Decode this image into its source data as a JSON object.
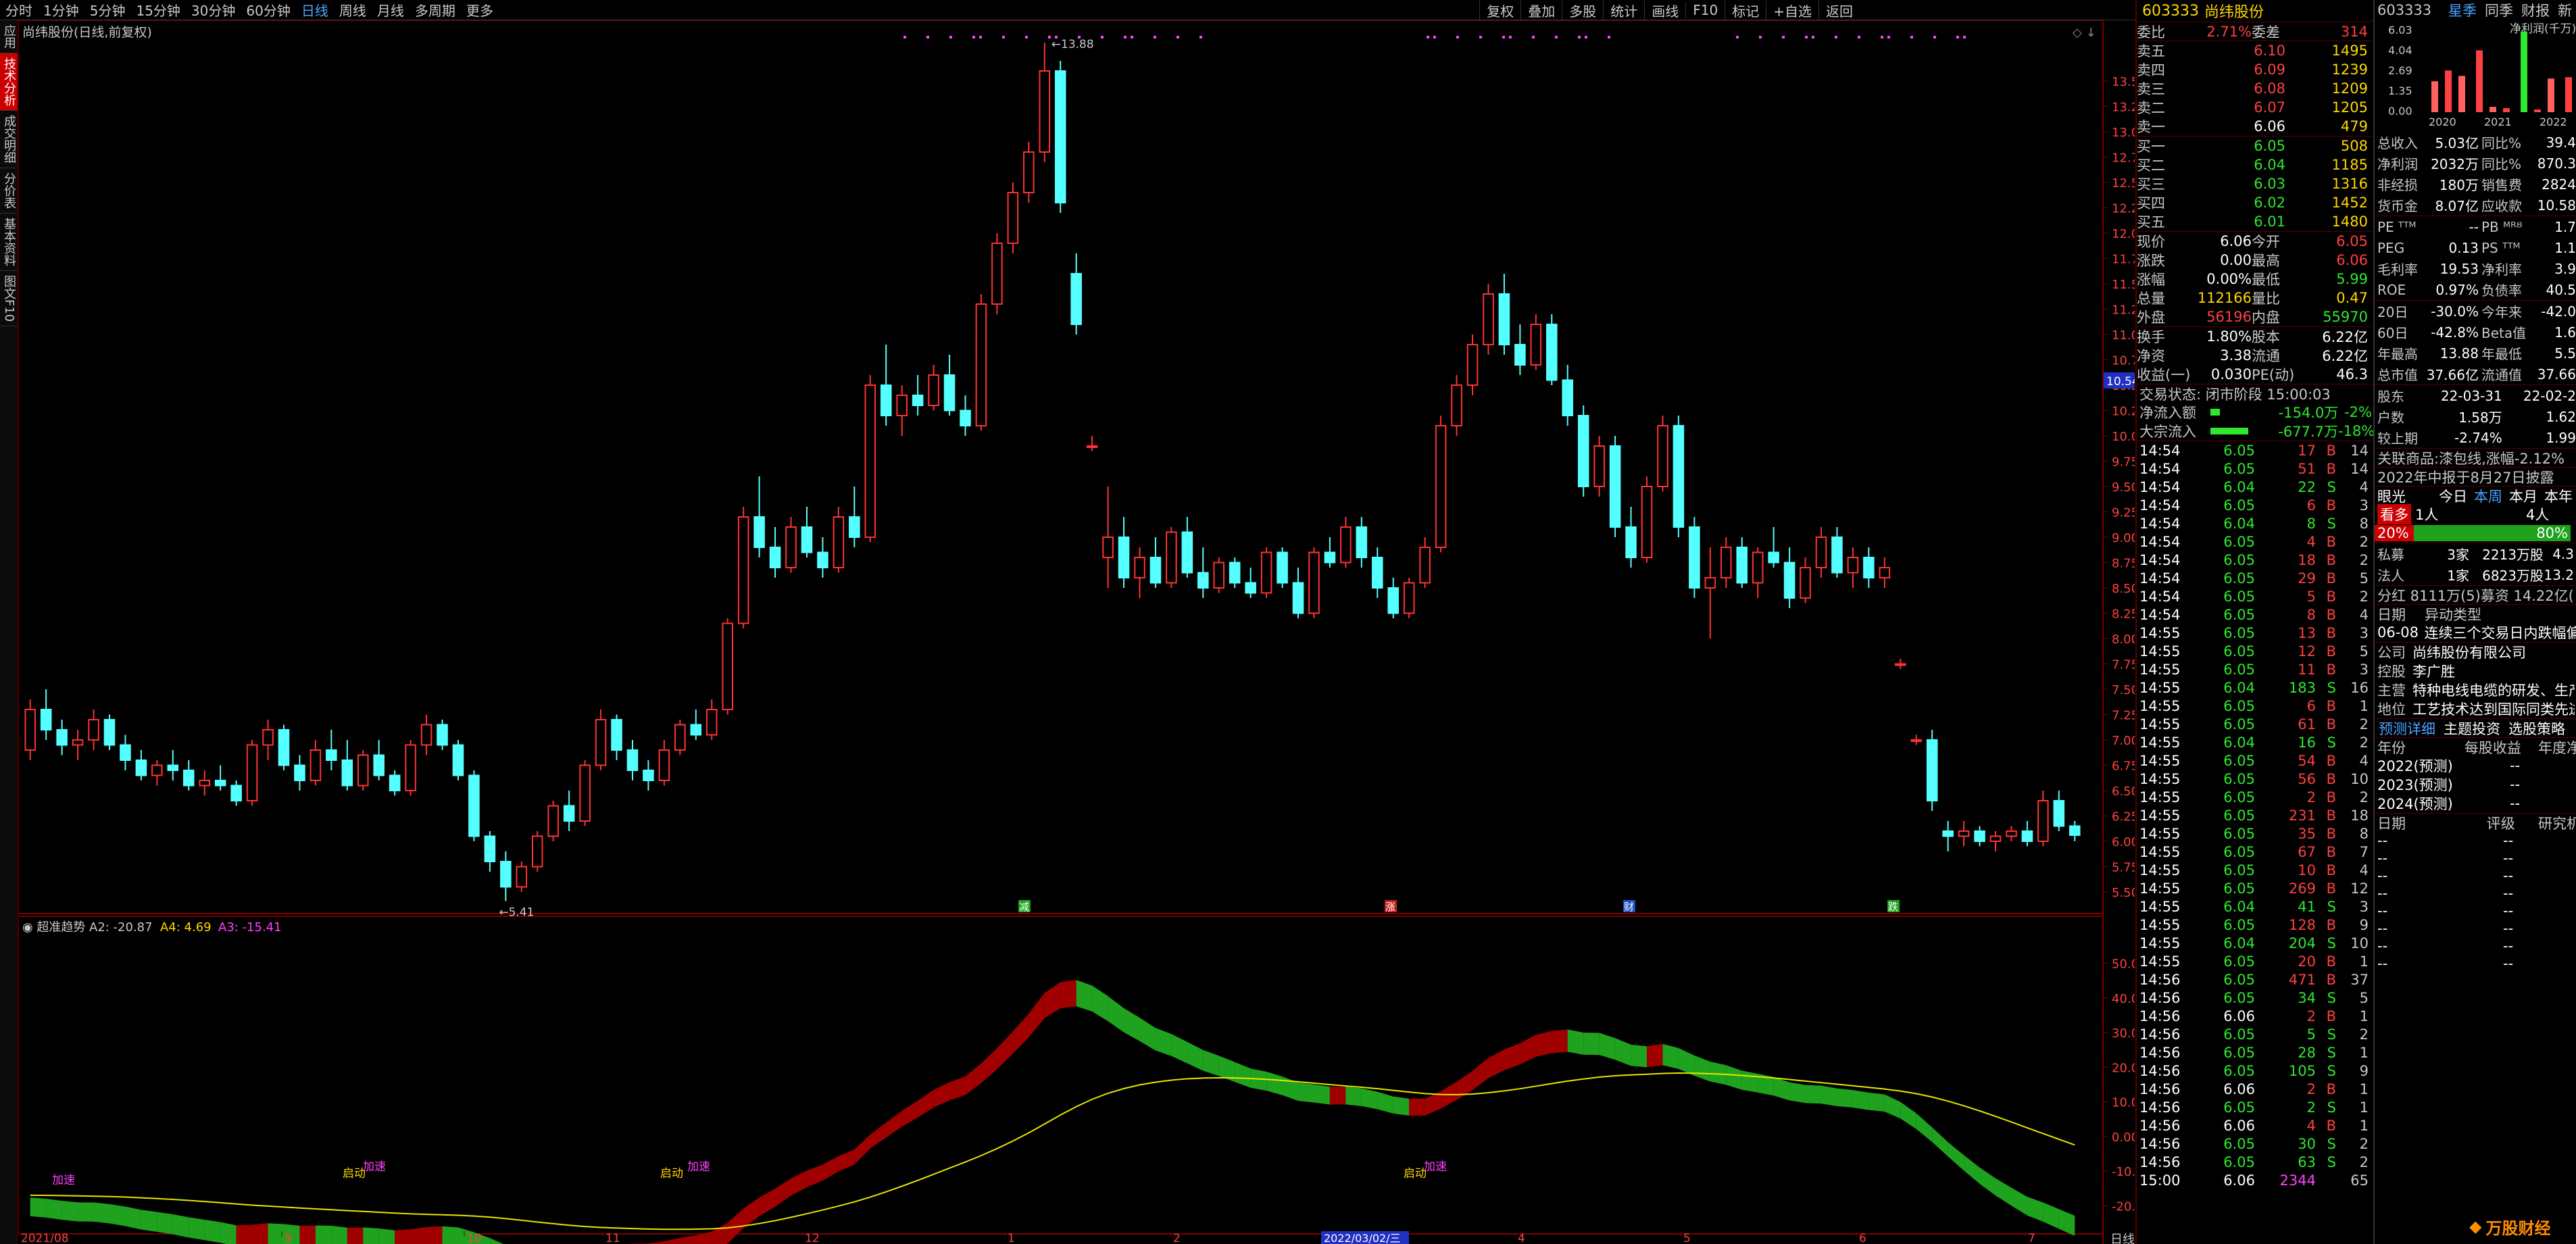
{
  "colors": {
    "up": "#ff3232",
    "down": "#54ffff",
    "bg": "#000000",
    "ma": "#e6e600",
    "bull": "#a00000",
    "bear": "#1fa31f"
  },
  "timeframes": [
    "分时",
    "1分钟",
    "5分钟",
    "15分钟",
    "30分钟",
    "60分钟",
    "日线",
    "周线",
    "月线",
    "多周期",
    "更多"
  ],
  "active_timeframe": "日线",
  "toolbar_right": [
    "复权",
    "叠加",
    "多股",
    "统计",
    "画线",
    "F10",
    "标记",
    "+自选",
    "返回"
  ],
  "left_tabs": [
    "应用",
    "技术分析",
    "成交明细",
    "分价表",
    "基本资料",
    "图文F10"
  ],
  "chart_title": "尚纬股份(日线,前复权)",
  "price_axis": [
    "13.50",
    "13.25",
    "13.00",
    "12.75",
    "12.50",
    "12.25",
    "12.00",
    "11.75",
    "11.50",
    "11.25",
    "11.00",
    "10.75",
    "10.50",
    "10.25",
    "10.00",
    "9.75",
    "9.50",
    "9.25",
    "9.00",
    "8.75",
    "8.50",
    "8.25",
    "8.00",
    "7.75",
    "7.50",
    "7.25",
    "7.00",
    "6.75",
    "6.50",
    "6.25",
    "6.00",
    "5.75",
    "5.50"
  ],
  "price_badge": "10.54",
  "high_mark": "13.88",
  "low_mark": "5.41",
  "event_markers": [
    "减",
    "涨",
    "财",
    "跌"
  ],
  "indicator": {
    "name": "超准趋势",
    "a2": "A2: -20.87",
    "a4": "A4: 4.69",
    "a3": "A3: -15.41",
    "axis": [
      "50.00",
      "40.00",
      "30.00",
      "20.00",
      "10.00",
      "0.00",
      "-10.00",
      "-20.00"
    ],
    "labels": [
      "加速",
      "启动",
      "加速",
      "启动",
      "加速",
      "启动",
      "加速"
    ]
  },
  "date_axis": [
    "2021/08",
    "9",
    "10",
    "11",
    "12",
    "1",
    "2",
    "3",
    "4",
    "5",
    "6",
    "7"
  ],
  "date_badge": "2022/03/02/三",
  "bottom_tabs": [
    "设置"
  ],
  "bottom_right_tabs": [
    "指标P",
    "模",
    "板"
  ],
  "weekday_label": "日线",
  "chart_data": {
    "type": "candlestick",
    "ylim": [
      5.3,
      13.9
    ],
    "candles": [
      [
        6.9,
        7.4,
        6.8,
        7.3
      ],
      [
        7.3,
        7.5,
        7.0,
        7.1
      ],
      [
        7.1,
        7.2,
        6.85,
        6.95
      ],
      [
        6.95,
        7.1,
        6.8,
        7.0
      ],
      [
        7.0,
        7.3,
        6.9,
        7.2
      ],
      [
        7.2,
        7.25,
        6.9,
        6.95
      ],
      [
        6.95,
        7.05,
        6.7,
        6.8
      ],
      [
        6.8,
        6.9,
        6.6,
        6.65
      ],
      [
        6.65,
        6.8,
        6.55,
        6.75
      ],
      [
        6.75,
        6.9,
        6.6,
        6.7
      ],
      [
        6.7,
        6.8,
        6.5,
        6.55
      ],
      [
        6.55,
        6.7,
        6.45,
        6.6
      ],
      [
        6.6,
        6.75,
        6.5,
        6.55
      ],
      [
        6.55,
        6.6,
        6.35,
        6.4
      ],
      [
        6.4,
        7.0,
        6.35,
        6.95
      ],
      [
        6.95,
        7.2,
        6.8,
        7.1
      ],
      [
        7.1,
        7.15,
        6.7,
        6.75
      ],
      [
        6.75,
        6.85,
        6.5,
        6.6
      ],
      [
        6.6,
        7.0,
        6.55,
        6.9
      ],
      [
        6.9,
        7.1,
        6.7,
        6.8
      ],
      [
        6.8,
        7.0,
        6.5,
        6.55
      ],
      [
        6.55,
        6.9,
        6.5,
        6.85
      ],
      [
        6.85,
        7.0,
        6.6,
        6.65
      ],
      [
        6.65,
        6.7,
        6.45,
        6.5
      ],
      [
        6.5,
        7.0,
        6.45,
        6.95
      ],
      [
        6.95,
        7.25,
        6.85,
        7.15
      ],
      [
        7.15,
        7.2,
        6.9,
        6.95
      ],
      [
        6.95,
        7.0,
        6.6,
        6.65
      ],
      [
        6.65,
        6.7,
        6.0,
        6.05
      ],
      [
        6.05,
        6.1,
        5.7,
        5.8
      ],
      [
        5.8,
        5.9,
        5.41,
        5.55
      ],
      [
        5.55,
        5.8,
        5.5,
        5.75
      ],
      [
        5.75,
        6.1,
        5.7,
        6.05
      ],
      [
        6.05,
        6.4,
        6.0,
        6.35
      ],
      [
        6.35,
        6.5,
        6.1,
        6.2
      ],
      [
        6.2,
        6.8,
        6.15,
        6.75
      ],
      [
        6.75,
        7.3,
        6.7,
        7.2
      ],
      [
        7.2,
        7.25,
        6.8,
        6.9
      ],
      [
        6.9,
        7.0,
        6.6,
        6.7
      ],
      [
        6.7,
        6.8,
        6.5,
        6.6
      ],
      [
        6.6,
        7.0,
        6.55,
        6.9
      ],
      [
        6.9,
        7.2,
        6.85,
        7.15
      ],
      [
        7.15,
        7.3,
        7.0,
        7.05
      ],
      [
        7.05,
        7.4,
        7.0,
        7.3
      ],
      [
        7.3,
        8.2,
        7.25,
        8.15
      ],
      [
        8.15,
        9.3,
        8.1,
        9.2
      ],
      [
        9.2,
        9.6,
        8.8,
        8.9
      ],
      [
        8.9,
        9.1,
        8.6,
        8.7
      ],
      [
        8.7,
        9.2,
        8.65,
        9.1
      ],
      [
        9.1,
        9.3,
        8.8,
        8.85
      ],
      [
        8.85,
        9.0,
        8.6,
        8.7
      ],
      [
        8.7,
        9.3,
        8.65,
        9.2
      ],
      [
        9.2,
        9.5,
        8.9,
        9.0
      ],
      [
        9.0,
        10.6,
        8.95,
        10.5
      ],
      [
        10.5,
        10.9,
        10.1,
        10.2
      ],
      [
        10.2,
        10.5,
        10.0,
        10.4
      ],
      [
        10.4,
        10.6,
        10.2,
        10.3
      ],
      [
        10.3,
        10.7,
        10.25,
        10.6
      ],
      [
        10.6,
        10.8,
        10.2,
        10.25
      ],
      [
        10.25,
        10.4,
        10.0,
        10.1
      ],
      [
        10.1,
        11.4,
        10.05,
        11.3
      ],
      [
        11.3,
        12.0,
        11.2,
        11.9
      ],
      [
        11.9,
        12.5,
        11.8,
        12.4
      ],
      [
        12.4,
        12.9,
        12.3,
        12.8
      ],
      [
        12.8,
        13.88,
        12.7,
        13.6
      ],
      [
        13.6,
        13.7,
        12.2,
        12.3
      ],
      [
        11.6,
        11.8,
        11.0,
        11.1
      ],
      [
        9.9,
        10.0,
        9.85,
        9.9
      ],
      [
        8.8,
        9.5,
        8.5,
        9.0
      ],
      [
        9.0,
        9.2,
        8.5,
        8.6
      ],
      [
        8.6,
        8.9,
        8.4,
        8.8
      ],
      [
        8.8,
        9.0,
        8.5,
        8.55
      ],
      [
        8.55,
        9.1,
        8.5,
        9.05
      ],
      [
        9.05,
        9.2,
        8.6,
        8.65
      ],
      [
        8.65,
        8.9,
        8.4,
        8.5
      ],
      [
        8.5,
        8.8,
        8.45,
        8.75
      ],
      [
        8.75,
        8.8,
        8.5,
        8.55
      ],
      [
        8.55,
        8.7,
        8.4,
        8.45
      ],
      [
        8.45,
        8.9,
        8.4,
        8.85
      ],
      [
        8.85,
        8.9,
        8.5,
        8.55
      ],
      [
        8.55,
        8.7,
        8.2,
        8.25
      ],
      [
        8.25,
        8.9,
        8.2,
        8.85
      ],
      [
        8.85,
        9.0,
        8.7,
        8.75
      ],
      [
        8.75,
        9.2,
        8.7,
        9.1
      ],
      [
        9.1,
        9.2,
        8.7,
        8.8
      ],
      [
        8.8,
        8.9,
        8.4,
        8.5
      ],
      [
        8.5,
        8.6,
        8.2,
        8.25
      ],
      [
        8.25,
        8.6,
        8.2,
        8.55
      ],
      [
        8.55,
        9.0,
        8.5,
        8.9
      ],
      [
        8.9,
        10.2,
        8.85,
        10.1
      ],
      [
        10.1,
        10.6,
        10.0,
        10.5
      ],
      [
        10.5,
        11.0,
        10.4,
        10.9
      ],
      [
        10.9,
        11.5,
        10.8,
        11.4
      ],
      [
        11.4,
        11.6,
        10.8,
        10.9
      ],
      [
        10.9,
        11.1,
        10.6,
        10.7
      ],
      [
        10.7,
        11.2,
        10.65,
        11.1
      ],
      [
        11.1,
        11.2,
        10.5,
        10.55
      ],
      [
        10.55,
        10.7,
        10.1,
        10.2
      ],
      [
        10.2,
        10.3,
        9.4,
        9.5
      ],
      [
        9.5,
        10.0,
        9.4,
        9.9
      ],
      [
        9.9,
        10.0,
        9.0,
        9.1
      ],
      [
        9.1,
        9.3,
        8.7,
        8.8
      ],
      [
        8.8,
        9.6,
        8.75,
        9.5
      ],
      [
        9.5,
        10.2,
        9.45,
        10.1
      ],
      [
        10.1,
        10.2,
        9.0,
        9.1
      ],
      [
        9.1,
        9.2,
        8.4,
        8.5
      ],
      [
        8.5,
        8.9,
        8.0,
        8.6
      ],
      [
        8.6,
        9.0,
        8.5,
        8.9
      ],
      [
        8.9,
        9.0,
        8.5,
        8.55
      ],
      [
        8.55,
        8.9,
        8.4,
        8.85
      ],
      [
        8.85,
        9.1,
        8.7,
        8.75
      ],
      [
        8.75,
        8.9,
        8.3,
        8.4
      ],
      [
        8.4,
        8.8,
        8.35,
        8.7
      ],
      [
        8.7,
        9.1,
        8.6,
        9.0
      ],
      [
        9.0,
        9.1,
        8.6,
        8.65
      ],
      [
        8.65,
        8.9,
        8.5,
        8.8
      ],
      [
        8.8,
        8.9,
        8.5,
        8.6
      ],
      [
        8.6,
        8.8,
        8.5,
        8.7
      ],
      [
        7.75,
        7.8,
        7.7,
        7.75
      ],
      [
        7.0,
        7.05,
        6.95,
        7.0
      ],
      [
        7.0,
        7.1,
        6.3,
        6.4
      ],
      [
        6.1,
        6.2,
        5.9,
        6.05
      ],
      [
        6.05,
        6.2,
        5.95,
        6.1
      ],
      [
        6.1,
        6.15,
        5.95,
        6.0
      ],
      [
        6.0,
        6.1,
        5.9,
        6.05
      ],
      [
        6.05,
        6.15,
        6.0,
        6.1
      ],
      [
        6.1,
        6.2,
        5.95,
        6.0
      ],
      [
        6.0,
        6.5,
        5.95,
        6.4
      ],
      [
        6.4,
        6.5,
        6.1,
        6.15
      ],
      [
        6.15,
        6.2,
        6.0,
        6.06
      ]
    ]
  },
  "quote": {
    "code": "603333",
    "name": "尚纬股份",
    "webi_label": "委比",
    "webi": "2.71%",
    "weicha_label": "委差",
    "weicha": "314",
    "asks": [
      [
        "卖五",
        "6.10",
        "1495"
      ],
      [
        "卖四",
        "6.09",
        "1239"
      ],
      [
        "卖三",
        "6.08",
        "1209"
      ],
      [
        "卖二",
        "6.07",
        "1205"
      ],
      [
        "卖一",
        "6.06",
        "479"
      ]
    ],
    "bids": [
      [
        "买一",
        "6.05",
        "508"
      ],
      [
        "买二",
        "6.04",
        "1185"
      ],
      [
        "买三",
        "6.03",
        "1316"
      ],
      [
        "买四",
        "6.02",
        "1452"
      ],
      [
        "买五",
        "6.01",
        "1480"
      ]
    ],
    "stats": [
      [
        "现价",
        "6.06",
        "今开",
        "6.05"
      ],
      [
        "涨跌",
        "0.00",
        "最高",
        "6.06"
      ],
      [
        "涨幅",
        "0.00%",
        "最低",
        "5.99"
      ],
      [
        "总量",
        "112166",
        "量比",
        "0.47"
      ],
      [
        "外盘",
        "56196",
        "内盘",
        "55970"
      ]
    ],
    "stats2": [
      [
        "换手",
        "1.80%",
        "股本",
        "6.22亿"
      ],
      [
        "净资",
        "3.38",
        "流通",
        "6.22亿"
      ],
      [
        "收益(一)",
        "0.030",
        "PE(动)",
        "46.3"
      ]
    ],
    "trade_status": "交易状态: 闭市阶段 15:00:03",
    "flows": [
      [
        "净流入额",
        "-154.0万",
        "-2%"
      ],
      [
        "大宗流入",
        "-677.7万",
        "-18%"
      ]
    ],
    "ticks": [
      [
        "14:54",
        "6.05",
        "17",
        "B",
        "14"
      ],
      [
        "14:54",
        "6.05",
        "51",
        "B",
        "14"
      ],
      [
        "14:54",
        "6.04",
        "22",
        "S",
        "4"
      ],
      [
        "14:54",
        "6.05",
        "6",
        "B",
        "3"
      ],
      [
        "14:54",
        "6.04",
        "8",
        "S",
        "8"
      ],
      [
        "14:54",
        "6.05",
        "4",
        "B",
        "2"
      ],
      [
        "14:54",
        "6.05",
        "18",
        "B",
        "2"
      ],
      [
        "14:54",
        "6.05",
        "29",
        "B",
        "5"
      ],
      [
        "14:54",
        "6.05",
        "5",
        "B",
        "2"
      ],
      [
        "14:54",
        "6.05",
        "8",
        "B",
        "4"
      ],
      [
        "14:55",
        "6.05",
        "13",
        "B",
        "3"
      ],
      [
        "14:55",
        "6.05",
        "12",
        "B",
        "5"
      ],
      [
        "14:55",
        "6.05",
        "11",
        "B",
        "3"
      ],
      [
        "14:55",
        "6.04",
        "183",
        "S",
        "16"
      ],
      [
        "14:55",
        "6.05",
        "6",
        "B",
        "1"
      ],
      [
        "14:55",
        "6.05",
        "61",
        "B",
        "2"
      ],
      [
        "14:55",
        "6.04",
        "16",
        "S",
        "2"
      ],
      [
        "14:55",
        "6.05",
        "54",
        "B",
        "4"
      ],
      [
        "14:55",
        "6.05",
        "56",
        "B",
        "10"
      ],
      [
        "14:55",
        "6.05",
        "2",
        "B",
        "2"
      ],
      [
        "14:55",
        "6.05",
        "231",
        "B",
        "18"
      ],
      [
        "14:55",
        "6.05",
        "35",
        "B",
        "8"
      ],
      [
        "14:55",
        "6.05",
        "67",
        "B",
        "7"
      ],
      [
        "14:55",
        "6.05",
        "10",
        "B",
        "4"
      ],
      [
        "14:55",
        "6.05",
        "269",
        "B",
        "12"
      ],
      [
        "14:55",
        "6.04",
        "41",
        "S",
        "3"
      ],
      [
        "14:55",
        "6.05",
        "128",
        "B",
        "9"
      ],
      [
        "14:55",
        "6.04",
        "204",
        "S",
        "10"
      ],
      [
        "14:55",
        "6.05",
        "20",
        "B",
        "1"
      ],
      [
        "14:56",
        "6.05",
        "471",
        "B",
        "37"
      ],
      [
        "14:56",
        "6.05",
        "34",
        "S",
        "5"
      ],
      [
        "14:56",
        "6.06",
        "2",
        "B",
        "1"
      ],
      [
        "14:56",
        "6.05",
        "5",
        "S",
        "2"
      ],
      [
        "14:56",
        "6.05",
        "28",
        "S",
        "1"
      ],
      [
        "14:56",
        "6.05",
        "105",
        "S",
        "9"
      ],
      [
        "14:56",
        "6.06",
        "2",
        "B",
        "1"
      ],
      [
        "14:56",
        "6.05",
        "2",
        "S",
        "1"
      ],
      [
        "14:56",
        "6.06",
        "4",
        "B",
        "1"
      ],
      [
        "14:56",
        "6.05",
        "30",
        "S",
        "2"
      ],
      [
        "14:56",
        "6.05",
        "63",
        "S",
        "2"
      ],
      [
        "15:00",
        "6.06",
        "2344",
        "",
        "65"
      ]
    ]
  },
  "info": {
    "code": "603333",
    "tabs": [
      "星季",
      "同季",
      "财报",
      "新"
    ],
    "mini_chart_title": "净利润(千万)",
    "mini_axis": [
      "6.03",
      "4.04",
      "2.69",
      "1.35",
      "0.00"
    ],
    "mini_years": [
      "2020",
      "2021",
      "2022"
    ],
    "mini_bars": [
      2.3,
      3.1,
      2.7,
      4.6,
      0.4,
      0.3,
      6.0,
      0.2,
      2.5,
      2.6
    ],
    "fin": [
      [
        "总收入",
        "5.03亿",
        "同比%",
        "39.4"
      ],
      [
        "净利润",
        "2032万",
        "同比%",
        "870.3"
      ],
      [
        "非经损",
        "180万",
        "销售费",
        "2824"
      ],
      [
        "货币金",
        "8.07亿",
        "应收款",
        "10.58"
      ]
    ],
    "val": [
      [
        "PE ᵀᵀᴹ",
        "--",
        "PB ᴹᴿᴽ",
        "1.7"
      ],
      [
        "PEG",
        "0.13",
        "PS ᵀᵀᴹ",
        "1.1"
      ],
      [
        "毛利率",
        "19.53",
        "净利率",
        "3.9"
      ],
      [
        "ROE",
        "0.97%",
        "负债率",
        "40.5"
      ]
    ],
    "perf": [
      [
        "20日",
        "-30.0%",
        "今年来",
        "-42.0"
      ],
      [
        "60日",
        "-42.8%",
        "Beta值",
        "1.6"
      ],
      [
        "年最高",
        "13.88",
        "年最低",
        "5.5"
      ],
      [
        "总市值",
        "37.66亿",
        "流通值",
        "37.66"
      ]
    ],
    "holders": [
      [
        "股东",
        "22-03-31",
        "22-02-2"
      ],
      [
        "户数",
        "1.58万",
        "1.62"
      ],
      [
        "较上期",
        "-2.74%",
        "1.99"
      ]
    ],
    "related": "关联商品:漆包线,涨幅-2.12%",
    "report": "2022年中报于8月27日披露",
    "sentiment_label": "眼光",
    "sentiment_tabs": [
      "今日",
      "本周",
      "本月",
      "本年"
    ],
    "bull_label": "看多",
    "bull_count": "1人",
    "bear_count": "4人",
    "bull_pct": "20%",
    "bear_pct": "80%",
    "inst": [
      [
        "私募",
        "3家",
        "2213万股",
        "4.3"
      ],
      [
        "法人",
        "1家",
        "6823万股",
        "13.2"
      ]
    ],
    "dividend": "分红 8111万(5)募资 14.22亿(",
    "move_head": [
      "日期",
      "异动类型"
    ],
    "move": [
      "06-08",
      "连续三个交易日内跌幅偏"
    ],
    "company": [
      [
        "公司",
        "尚纬股份有限公司"
      ],
      [
        "控股",
        "李广胜"
      ],
      [
        "主营",
        "特种电线电缆的研发、生产"
      ],
      [
        "地位",
        "工艺技术达到国际同类先进"
      ]
    ],
    "links": [
      "预测详细",
      "主题投资",
      "选股策略"
    ],
    "forecast_head": [
      "年份",
      "每股收益",
      "年度净"
    ],
    "forecast": [
      [
        "2022(预测)",
        "--"
      ],
      [
        "2023(预测)",
        "--"
      ],
      [
        "2024(预测)",
        "--"
      ]
    ],
    "rating_head": [
      "日期",
      "评级",
      "研究机"
    ],
    "logo_text": "万股财经"
  }
}
